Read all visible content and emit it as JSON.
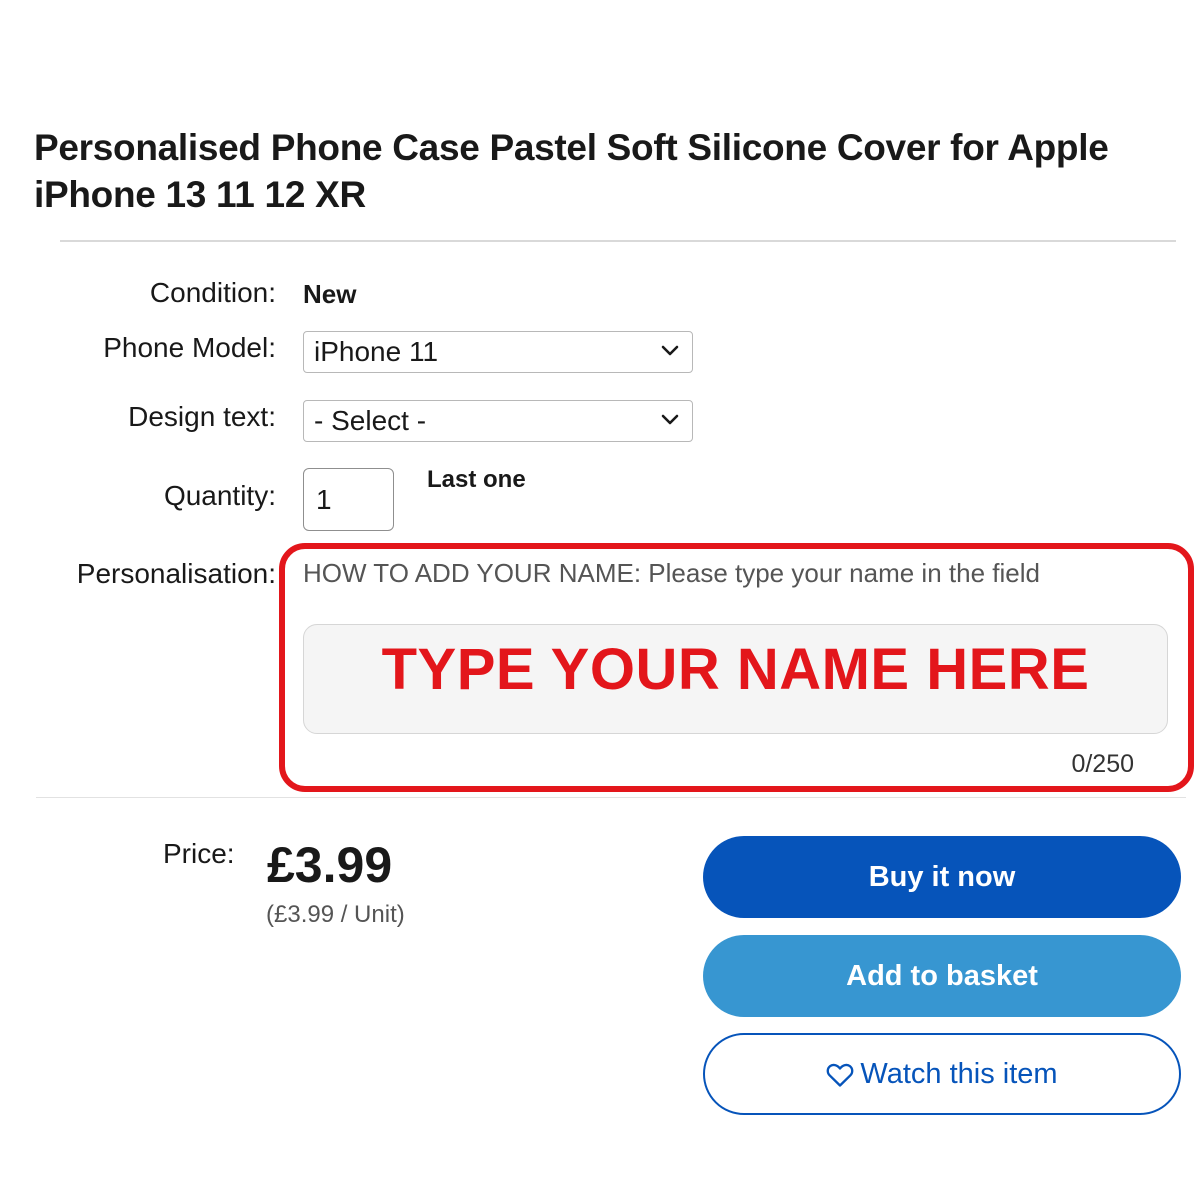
{
  "listing": {
    "title": "Personalised Phone Case Pastel Soft Silicone Cover for Apple iPhone 13 11 12 XR"
  },
  "fields": {
    "condition_label": "Condition:",
    "condition_value": "New",
    "phone_model_label": "Phone Model:",
    "phone_model_value": "iPhone 11",
    "design_text_label": "Design text:",
    "design_text_value": "- Select -",
    "quantity_label": "Quantity:",
    "quantity_value": "1",
    "stock_note": "Last one",
    "personalisation_label": "Personalisation:",
    "personalisation_instructions": "HOW TO ADD YOUR NAME: Please type your name in the field",
    "personalisation_placeholder": "TYPE YOUR NAME HERE",
    "personalisation_counter": "0/250"
  },
  "pricing": {
    "price_label": "Price:",
    "price": "£3.99",
    "unit_price": "(£3.99 / Unit)"
  },
  "actions": {
    "buy_now": "Buy it now",
    "add_to_basket": "Add to basket",
    "watch": "Watch this item"
  },
  "icons": {
    "dropdown": "chevron-down-icon",
    "watch": "heart-icon"
  },
  "colors": {
    "primary_blue": "#0654ba",
    "secondary_blue": "#3796d1",
    "highlight_red": "#e3161b"
  }
}
